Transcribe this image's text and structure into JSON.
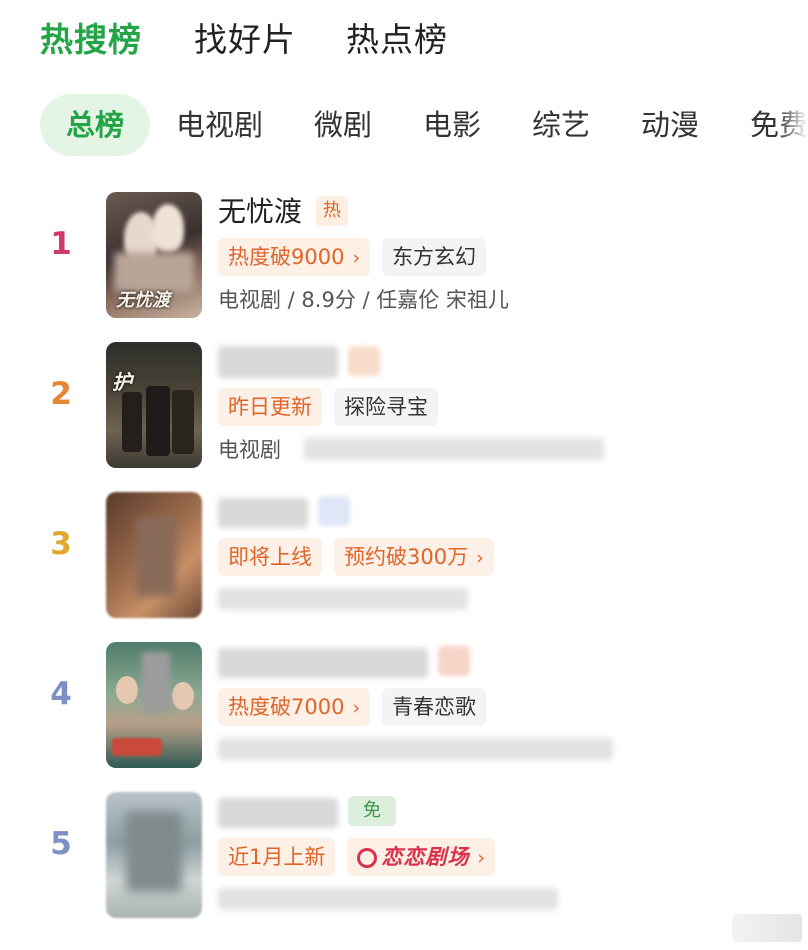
{
  "top_tabs": [
    {
      "label": "热搜榜",
      "active": true
    },
    {
      "label": "找好片",
      "active": false
    },
    {
      "label": "热点榜",
      "active": false
    }
  ],
  "sub_tabs": [
    {
      "label": "总榜",
      "active": true
    },
    {
      "label": "电视剧",
      "active": false
    },
    {
      "label": "微剧",
      "active": false
    },
    {
      "label": "电影",
      "active": false
    },
    {
      "label": "综艺",
      "active": false
    },
    {
      "label": "动漫",
      "active": false
    },
    {
      "label": "免费",
      "active": false
    }
  ],
  "ranking": [
    {
      "rank": "1",
      "title": "无忧渡",
      "title_badge": "热",
      "poster_text": "无忧渡",
      "tags": [
        {
          "text": "热度破9000",
          "style": "orange",
          "arrow": "›"
        },
        {
          "text": "东方玄幻",
          "style": "gray"
        }
      ],
      "meta": "电视剧 / 8.9分 / 任嘉伦 宋祖儿"
    },
    {
      "rank": "2",
      "poster_text": "护",
      "tags": [
        {
          "text": "昨日更新",
          "style": "orange"
        },
        {
          "text": "探险寻宝",
          "style": "gray"
        }
      ],
      "meta": "电视剧"
    },
    {
      "rank": "3",
      "tags": [
        {
          "text": "即将上线",
          "style": "orange"
        },
        {
          "text": "预约破300万",
          "style": "orange",
          "arrow": "›"
        }
      ]
    },
    {
      "rank": "4",
      "tags": [
        {
          "text": "热度破7000",
          "style": "orange",
          "arrow": "›"
        },
        {
          "text": "青春恋歌",
          "style": "gray"
        }
      ]
    },
    {
      "rank": "5",
      "title_badge": "免",
      "tags": [
        {
          "text": "近1月上新",
          "style": "orange"
        },
        {
          "text": "恋恋剧场",
          "style": "brand",
          "arrow": "›"
        }
      ]
    }
  ],
  "colors": {
    "accent_green": "#22a447",
    "rank_1": "#d23a6a",
    "rank_2": "#e58632",
    "rank_3": "#e0a82e",
    "rank_4_5": "#7d8fc4",
    "tag_orange": "#e0652b"
  }
}
